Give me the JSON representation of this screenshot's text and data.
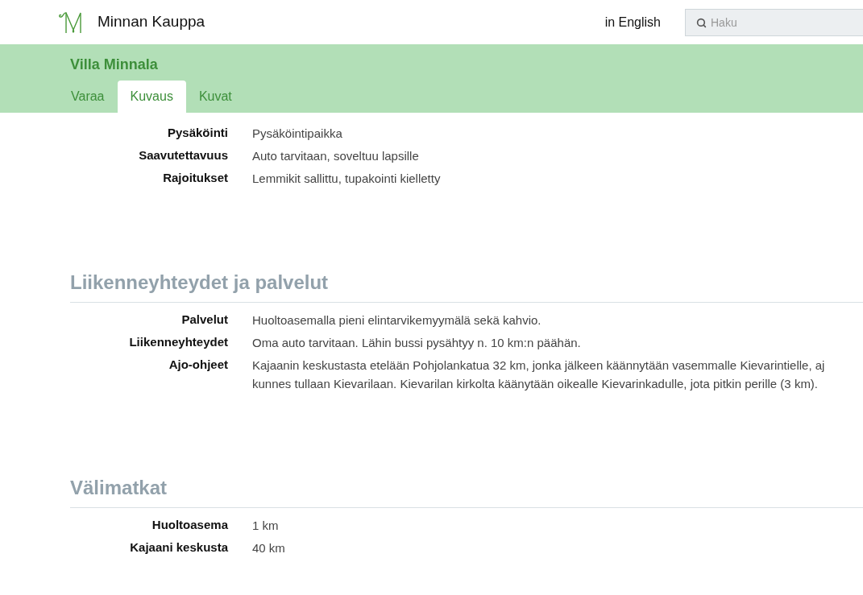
{
  "header": {
    "brand": "Minnan Kauppa",
    "language_link": "in English",
    "search": {
      "placeholder": "Haku"
    }
  },
  "property": {
    "title": "Villa Minnala",
    "tabs": [
      {
        "label": "Varaa",
        "selected": false
      },
      {
        "label": "Kuvaus",
        "selected": true
      },
      {
        "label": "Kuvat",
        "selected": false
      }
    ]
  },
  "sections": [
    {
      "rows": [
        {
          "label": "Pysäköinti",
          "lines": [
            "Pysäköintipaikka"
          ]
        },
        {
          "label": "Saavutettavuus",
          "lines": [
            "Auto tarvitaan, soveltuu lapsille"
          ]
        },
        {
          "label": "Rajoitukset",
          "lines": [
            "Lemmikit sallittu, tupakointi kielletty"
          ]
        }
      ]
    },
    {
      "title": "Liikenneyhteydet ja palvelut",
      "rows": [
        {
          "label": "Palvelut",
          "lines": [
            "Huoltoasemalla pieni elintarvikemyymälä sekä kahvio."
          ]
        },
        {
          "label": "Liikenneyhteydet",
          "lines": [
            "Oma auto tarvitaan. Lähin bussi pysähtyy n. 10 km:n päähän."
          ]
        },
        {
          "label": "Ajo-ohjeet",
          "lines": [
            "Kajaanin keskustasta etelään Pohjolankatua 32 km, jonka jälkeen käännytään vasemmalle Kievarintielle, aj",
            "kunnes tullaan Kievarilaan. Kievarilan kirkolta käänytään oikealle Kievarinkadulle, jota pitkin perille (3 km)."
          ]
        }
      ]
    },
    {
      "title": "Välimatkat",
      "rows": [
        {
          "label": "Huoltoasema",
          "lines": [
            "1 km"
          ]
        },
        {
          "label": "Kajaani keskusta",
          "lines": [
            "40 km"
          ]
        }
      ]
    }
  ]
}
